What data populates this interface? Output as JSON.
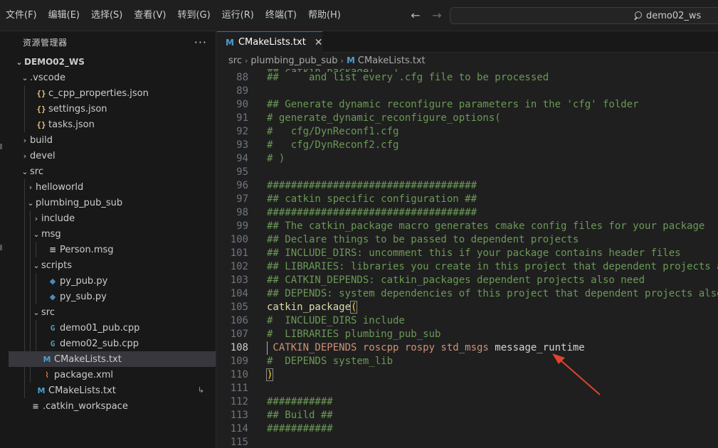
{
  "menu": [
    "文件(F)",
    "编辑(E)",
    "选择(S)",
    "查看(V)",
    "转到(G)",
    "运行(R)",
    "终端(T)",
    "帮助(H)"
  ],
  "search": {
    "text": "demo02_ws"
  },
  "sidebar": {
    "title": "资源管理器",
    "more": "···",
    "items": [
      {
        "label": "DEMO02_WS",
        "chev": "⌄",
        "icon": "",
        "indent": 0,
        "kind": "root"
      },
      {
        "label": ".vscode",
        "chev": "⌄",
        "icon": "",
        "indent": 1
      },
      {
        "label": "c_cpp_properties.json",
        "chev": "",
        "icon": "{}",
        "iconClass": "json",
        "indent": 2
      },
      {
        "label": "settings.json",
        "chev": "",
        "icon": "{}",
        "iconClass": "json",
        "indent": 2
      },
      {
        "label": "tasks.json",
        "chev": "",
        "icon": "{}",
        "iconClass": "json",
        "indent": 2
      },
      {
        "label": "build",
        "chev": "›",
        "icon": "",
        "indent": 1
      },
      {
        "label": "devel",
        "chev": "›",
        "icon": "",
        "indent": 1
      },
      {
        "label": "src",
        "chev": "⌄",
        "icon": "",
        "indent": 1
      },
      {
        "label": "helloworld",
        "chev": "›",
        "icon": "",
        "indent": 2
      },
      {
        "label": "plumbing_pub_sub",
        "chev": "⌄",
        "icon": "",
        "indent": 2
      },
      {
        "label": "include",
        "chev": "›",
        "icon": "",
        "indent": 3
      },
      {
        "label": "msg",
        "chev": "⌄",
        "icon": "",
        "indent": 3
      },
      {
        "label": "Person.msg",
        "chev": "",
        "icon": "≡",
        "iconClass": "msg",
        "indent": 4
      },
      {
        "label": "scripts",
        "chev": "⌄",
        "icon": "",
        "indent": 3
      },
      {
        "label": "py_pub.py",
        "chev": "",
        "icon": "◆",
        "iconClass": "py",
        "indent": 4
      },
      {
        "label": "py_sub.py",
        "chev": "",
        "icon": "◆",
        "iconClass": "py",
        "indent": 4
      },
      {
        "label": "src",
        "chev": "⌄",
        "icon": "",
        "indent": 3
      },
      {
        "label": "demo01_pub.cpp",
        "chev": "",
        "icon": "G",
        "iconClass": "cpp",
        "indent": 4
      },
      {
        "label": "demo02_sub.cpp",
        "chev": "",
        "icon": "G",
        "iconClass": "cpp",
        "indent": 4
      },
      {
        "label": "CMakeLists.txt",
        "chev": "",
        "icon": "M",
        "iconClass": "cmake",
        "indent": 3,
        "selected": true
      },
      {
        "label": "package.xml",
        "chev": "",
        "icon": "⌇",
        "iconClass": "xml",
        "indent": 3
      },
      {
        "label": "CMakeLists.txt",
        "chev": "",
        "icon": "M",
        "iconClass": "cmake",
        "indent": 2,
        "trail": "↳"
      },
      {
        "label": ".catkin_workspace",
        "chev": "",
        "icon": "≡",
        "iconClass": "ws",
        "indent": 1
      }
    ]
  },
  "editor": {
    "tab": {
      "label": "CMakeLists.txt",
      "close": "✕",
      "icon": "M"
    },
    "breadcrumb": [
      "src",
      "plumbing_pub_sub",
      "CMakeLists.txt"
    ],
    "ghost": "## catkin_package(...) ...",
    "lines": [
      {
        "n": "88",
        "t": "##     and list every .cfg file to be processed",
        "c": "comment"
      },
      {
        "n": "89",
        "t": "",
        "c": "comment"
      },
      {
        "n": "90",
        "t": "## Generate dynamic reconfigure parameters in the 'cfg' folder",
        "c": "comment"
      },
      {
        "n": "91",
        "t": "# generate_dynamic_reconfigure_options(",
        "c": "comment"
      },
      {
        "n": "92",
        "t": "#   cfg/DynReconf1.cfg",
        "c": "comment"
      },
      {
        "n": "93",
        "t": "#   cfg/DynReconf2.cfg",
        "c": "comment"
      },
      {
        "n": "94",
        "t": "# )",
        "c": "comment"
      },
      {
        "n": "95",
        "t": "",
        "c": "comment"
      },
      {
        "n": "96",
        "t": "###################################",
        "c": "comment"
      },
      {
        "n": "97",
        "t": "## catkin specific configuration ##",
        "c": "comment"
      },
      {
        "n": "98",
        "t": "###################################",
        "c": "comment"
      },
      {
        "n": "99",
        "t": "## The catkin_package macro generates cmake config files for your package",
        "c": "comment"
      },
      {
        "n": "100",
        "t": "## Declare things to be passed to dependent projects",
        "c": "comment"
      },
      {
        "n": "101",
        "t": "## INCLUDE_DIRS: uncomment this if your package contains header files",
        "c": "comment"
      },
      {
        "n": "102",
        "t": "## LIBRARIES: libraries you create in this project that dependent projects also need",
        "c": "comment"
      },
      {
        "n": "103",
        "t": "## CATKIN_DEPENDS: catkin_packages dependent projects also need",
        "c": "comment"
      },
      {
        "n": "104",
        "t": "## DEPENDS: system dependencies of this project that dependent projects also need",
        "c": "comment"
      },
      {
        "n": "105",
        "t": "catkin_package",
        "c": "func",
        "suffix": "("
      },
      {
        "n": "106",
        "t": "#  INCLUDE_DIRS include",
        "c": "comment"
      },
      {
        "n": "107",
        "t": "#  LIBRARIES plumbing_pub_sub",
        "c": "comment"
      },
      {
        "n": "108",
        "t": " CATKIN_DEPENDS roscpp rospy std_msgs",
        "c": "const",
        "suffix2": " message_runtime",
        "active": true
      },
      {
        "n": "109",
        "t": "#  DEPENDS system_lib",
        "c": "comment"
      },
      {
        "n": "110",
        "t": ")",
        "c": "paren"
      },
      {
        "n": "111",
        "t": "",
        "c": "comment"
      },
      {
        "n": "112",
        "t": "###########",
        "c": "comment"
      },
      {
        "n": "113",
        "t": "## Build ##",
        "c": "comment"
      },
      {
        "n": "114",
        "t": "###########",
        "c": "comment"
      },
      {
        "n": "115",
        "t": "",
        "c": "comment"
      }
    ]
  },
  "colors": {
    "accent": "#0078d4",
    "annotation_arrow": "#e0432f",
    "comment": "#6a9955",
    "function": "#dcdcaa",
    "string_const": "#ce9178"
  }
}
